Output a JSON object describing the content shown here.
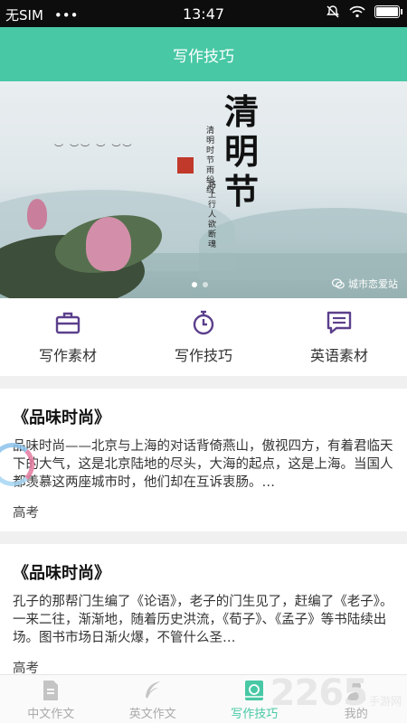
{
  "status_bar": {
    "carrier": "无SIM",
    "signal_dots": "•••",
    "time": "13:47"
  },
  "header": {
    "title": "写作技巧"
  },
  "banner": {
    "calligraphy": "清明节",
    "poem_line1": "清明时节雨纷纷",
    "poem_line2": "路上行人欲断魂",
    "seal_icon": "seal-icon",
    "watermark": "城市恋爱站",
    "page_count": 2,
    "active_page": 1
  },
  "categories": [
    {
      "label": "写作素材",
      "icon": "briefcase-icon",
      "color": "#5b3f8c"
    },
    {
      "label": "写作技巧",
      "icon": "stopwatch-icon",
      "color": "#5b3f8c"
    },
    {
      "label": "英语素材",
      "icon": "chat-icon",
      "color": "#5b3f8c"
    }
  ],
  "articles": [
    {
      "title": "《品味时尚》",
      "body": "品味时尚——北京与上海的对话背倚燕山，傲视四方，有着君临天下的大气，这是北京陆地的尽头，大海的起点，这是上海。当国人都羡慕这两座城市时，他们却在互诉衷肠。…",
      "tag": "高考"
    },
    {
      "title": "《品味时尚》",
      "body": "孔子的那帮门生编了《论语》，老子的门生见了，赶编了《老子》。一来二往，渐渐地，随着历史洪流，《荀子》、《孟子》等书陆续出场。图书市场日渐火爆，不管什么圣…",
      "tag": "高考"
    }
  ],
  "tabbar": {
    "tabs": [
      {
        "label": "中文作文",
        "icon": "document-icon",
        "active": false
      },
      {
        "label": "英文作文",
        "icon": "feather-icon",
        "active": false
      },
      {
        "label": "写作技巧",
        "icon": "book-icon",
        "active": true
      },
      {
        "label": "我的",
        "icon": "person-icon",
        "active": false
      }
    ],
    "active_color": "#48c8a5",
    "inactive_color": "#bbbbbb"
  },
  "brand_watermark": {
    "number": "2265",
    "site": "手游网"
  },
  "colors": {
    "accent": "#48c8a5",
    "icon_purple": "#5b3f8c"
  }
}
